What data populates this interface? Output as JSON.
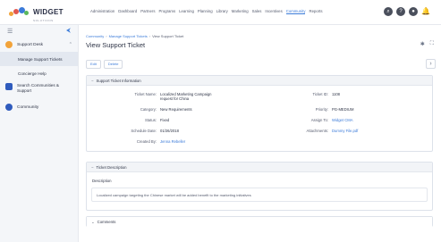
{
  "brand": {
    "name": "WIDGET",
    "sub": "SOLUTIONS"
  },
  "nav": [
    "Administration",
    "Dashboard",
    "Partners",
    "Programs",
    "Learning",
    "Planning",
    "Library",
    "Marketing",
    "Sales",
    "Incentives",
    "Community",
    "Reports"
  ],
  "nav_active_index": 10,
  "top_icons": [
    "search-icon",
    "help-icon",
    "user-icon",
    "bell-icon"
  ],
  "sidebar": {
    "group_label": "Support Desk",
    "items": [
      "Manage Support Tickets",
      "Concierge Help"
    ],
    "search_label": "Search Communities & Support",
    "community_label": "Community"
  },
  "breadcrumb": [
    "Community",
    "Manage Support Tickets",
    "View Support Ticket"
  ],
  "page_title": "View Support Ticket",
  "buttons": {
    "edit": "Edit",
    "delete": "Delete"
  },
  "info_section": {
    "title": "Support Ticket Information",
    "ticket_name_label": "Ticket Name:",
    "ticket_name": "Localized Marketing Campaign request for China",
    "category_label": "Category:",
    "category": "New Requirements",
    "status_label": "Status:",
    "status": "Fixed",
    "schedule_label": "Schedule Date:",
    "schedule": "01/26/2018",
    "created_label": "Created By:",
    "created_by": "Jenna Rebeller",
    "ticket_id_label": "Ticket ID:",
    "ticket_id": "1108",
    "priority_label": "Priority:",
    "priority": "PG-MEDIUM",
    "assign_label": "Assign To:",
    "assign_to": "Widget CMA",
    "attach_label": "Attachments:",
    "attachments": "Dummy File.pdf"
  },
  "desc_section": {
    "title": "Ticket Description",
    "label": "Description",
    "text": "Localized campaign targeting the Chinese market will be added benefit to the marketing initiatives"
  },
  "comments_section": {
    "title": "Comments"
  },
  "colors": {
    "accent": "#3b7bd9",
    "sidebar_bg": "#f4f6f9"
  }
}
